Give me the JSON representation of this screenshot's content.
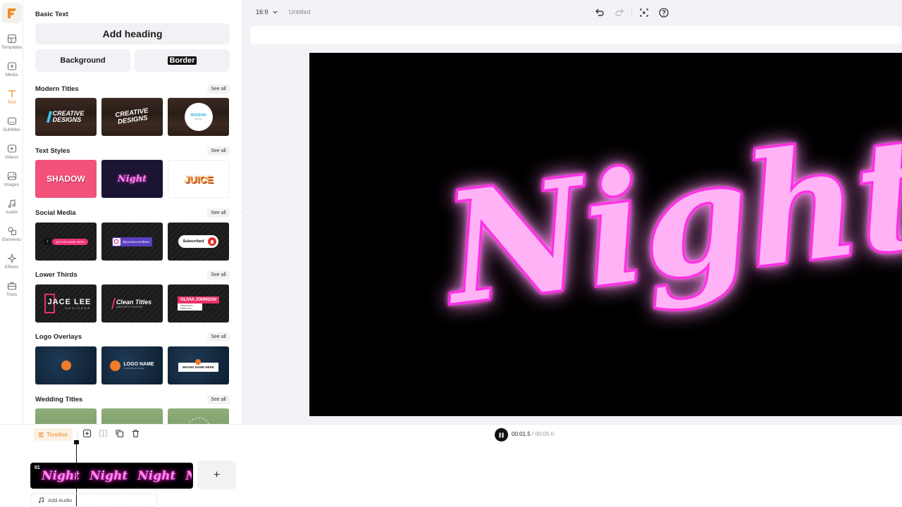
{
  "brand": {
    "logo_letter": "F",
    "accent": "#f08a24"
  },
  "rail": [
    {
      "label": "Templates",
      "icon": "layout-icon"
    },
    {
      "label": "Media",
      "icon": "media-plus-icon"
    },
    {
      "label": "Text",
      "icon": "text-icon",
      "active": true
    },
    {
      "label": "Subtitles",
      "icon": "subtitles-icon"
    },
    {
      "label": "Videos",
      "icon": "video-icon"
    },
    {
      "label": "Images",
      "icon": "image-icon"
    },
    {
      "label": "Audio",
      "icon": "music-icon"
    },
    {
      "label": "Elements",
      "icon": "shapes-icon"
    },
    {
      "label": "Effects",
      "icon": "sparkle-icon"
    },
    {
      "label": "Tools",
      "icon": "toolbox-icon"
    }
  ],
  "panel": {
    "basic_text": "Basic Text",
    "add_heading": "Add heading",
    "background": "Background",
    "border": "Border",
    "see_all": "See all",
    "sections": {
      "modern": "Modern Titles",
      "styles": "Text Styles",
      "social": "Social Media",
      "lower": "Lower Thirds",
      "logo": "Logo Overlays",
      "wedding": "Wedding Titles"
    },
    "thumbs": {
      "creative1_a": "CREATIVE",
      "creative1_b": "DESIGNS",
      "creative2_a": "CREATIVE",
      "creative2_b": "DESIGNS",
      "modern_a": "MODERN",
      "modern_b": "DESIGN",
      "shadow": "SHADOW",
      "night": "Night",
      "juice": "JUICE",
      "tiktok": "@YOUR NAME HERE",
      "insta": "@youraccounthere",
      "subscribed": "Subscribed",
      "jace": "JACE LEE",
      "designer": "DESIGNER",
      "clean": "Clean Titles",
      "clean_sub": "MADE WITH FLEXCLIP",
      "olivia": "OLIVIA JOHNSON",
      "olivia_sub": "MARKETING DIRECTOR",
      "logo_name": "LOGO NAME",
      "logo_sub": "YOUR BRAND HERE",
      "brand_name": "BRAND NAME HERE"
    }
  },
  "editor": {
    "ratio": "16:9",
    "title": "Untitled",
    "canvas_text": "Night",
    "neon_color": "#ff5ff0"
  },
  "timeline": {
    "label": "Timeline",
    "current": "00:01.5",
    "separator": "/",
    "total": "00:05.0",
    "clip_number": "01",
    "clip_word": "Night",
    "add": "+",
    "add_audio": "Add Audio"
  }
}
